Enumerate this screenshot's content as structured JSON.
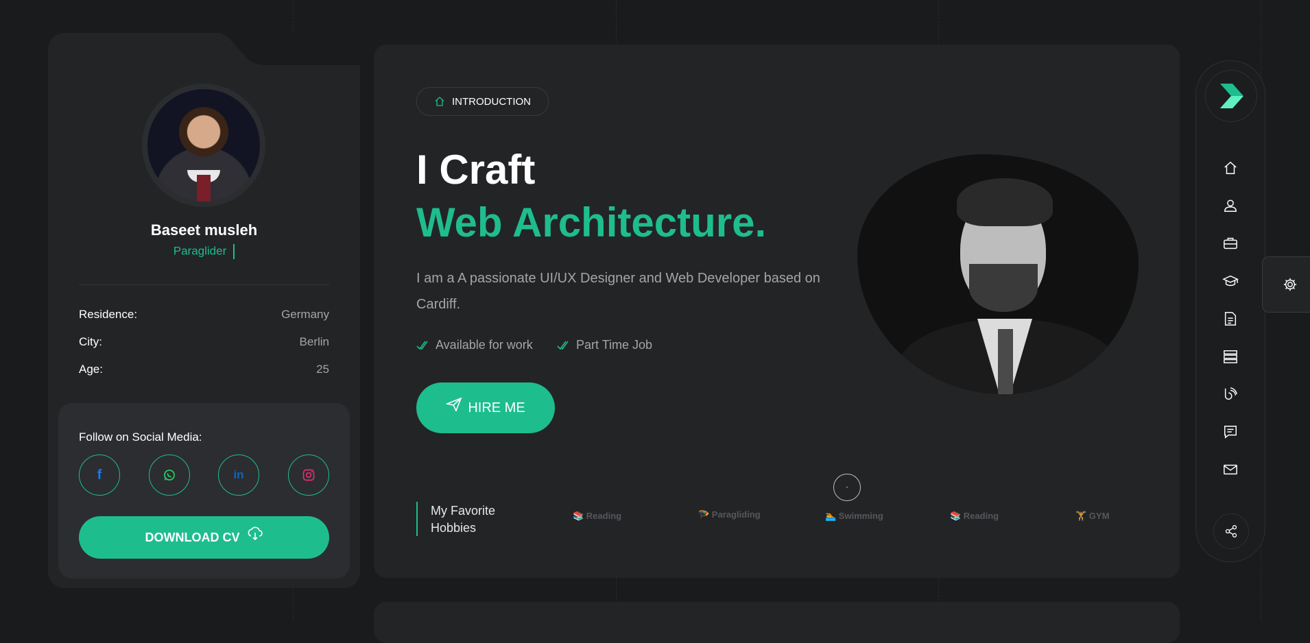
{
  "profile": {
    "name": "Baseet musleh",
    "role": "Paraglider",
    "info": [
      {
        "label": "Residence:",
        "value": "Germany"
      },
      {
        "label": "City:",
        "value": "Berlin"
      },
      {
        "label": "Age:",
        "value": "25"
      }
    ],
    "social_title": "Follow on Social Media:",
    "social": [
      {
        "icon": "facebook-icon",
        "color": "#1877f2"
      },
      {
        "icon": "whatsapp-icon",
        "color": "#25d366"
      },
      {
        "icon": "linkedin-icon",
        "color": "#0a66c2"
      },
      {
        "icon": "instagram-icon",
        "color": "#e1306c"
      }
    ],
    "download_label": "DOWNLOAD CV"
  },
  "hero": {
    "badge": "INTRODUCTION",
    "title_line1": "I Craft",
    "title_line2": "Web Architecture.",
    "description": "I am a A passionate UI/UX Designer and Web Developer based on Cardiff.",
    "checks": [
      "Available for work",
      "Part Time Job"
    ],
    "hire_label": "HIRE ME",
    "scroll_indicator": "◦"
  },
  "hobbies": {
    "title_line1": "My Favorite",
    "title_line2": "Hobbies",
    "items": [
      "📚 Reading",
      "🪂 Paragliding",
      "🏊 Swimming",
      "📚 Reading",
      "🏋 GYM"
    ]
  },
  "nav": {
    "items": [
      "home-icon",
      "user-icon",
      "briefcase-icon",
      "graduation-cap-icon",
      "document-icon",
      "server-icon",
      "blog-icon",
      "chat-icon",
      "mail-icon"
    ]
  },
  "colors": {
    "accent": "#1ebd8e",
    "background": "#1a1b1d",
    "card": "#232426"
  }
}
